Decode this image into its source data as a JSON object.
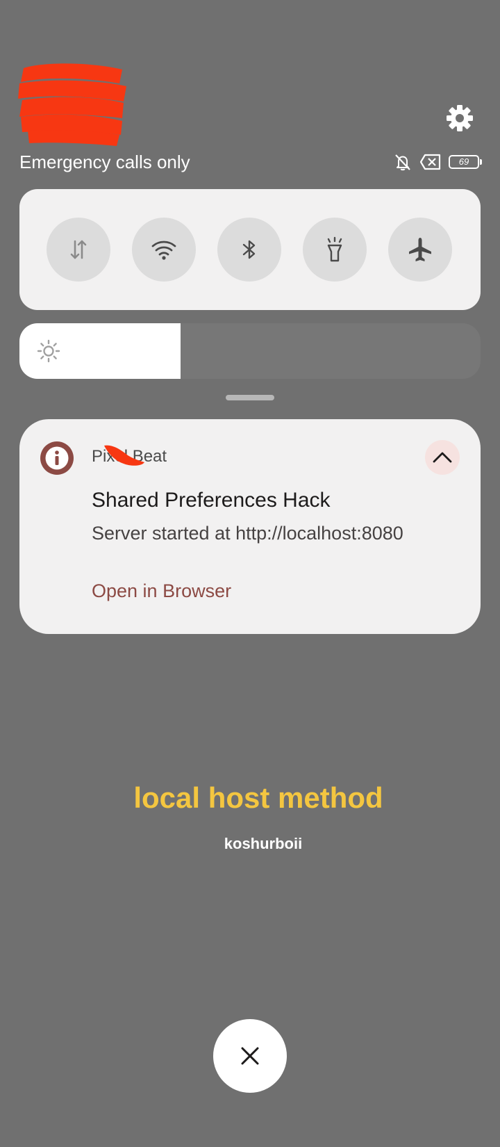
{
  "status_bar": {
    "carrier_text": "Emergency calls only",
    "battery_level": "69",
    "icons": [
      "bell-off-icon",
      "no-sim-icon",
      "battery-icon"
    ]
  },
  "header": {
    "settings_icon": "gear-icon"
  },
  "quick_settings": {
    "tiles": [
      {
        "name": "mobile-data",
        "icon": "data-arrows-icon"
      },
      {
        "name": "wifi",
        "icon": "wifi-icon"
      },
      {
        "name": "bluetooth",
        "icon": "bluetooth-icon"
      },
      {
        "name": "flashlight",
        "icon": "flashlight-icon"
      },
      {
        "name": "airplane-mode",
        "icon": "airplane-icon"
      }
    ]
  },
  "brightness": {
    "level_fraction": 0.35,
    "icon": "sun-icon"
  },
  "notification": {
    "app_name": "Pixel Beat",
    "title": "Shared Preferences Hack",
    "text": "Server started at http://localhost:8080",
    "action_label": "Open in Browser",
    "app_icon": "info-icon",
    "expand_icon": "chevron-up-icon"
  },
  "caption": {
    "title": "local host method",
    "author": "koshurboii"
  },
  "colors": {
    "background": "#707070",
    "panel": "#f2f1f1",
    "accent": "#8c4a44",
    "caption_title": "#f4c640",
    "redaction": "#f73712"
  }
}
